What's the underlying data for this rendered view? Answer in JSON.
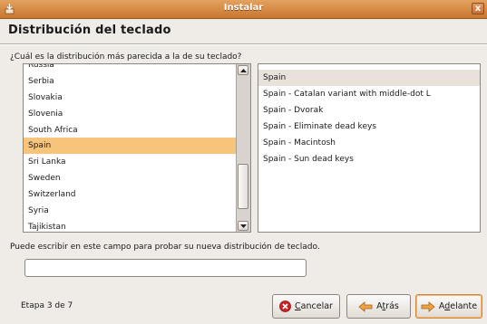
{
  "window": {
    "title": "Instalar",
    "close_label": "x"
  },
  "page": {
    "heading": "Distribución del teclado",
    "question": "¿Cuál es la distribución más parecida a la de su teclado?"
  },
  "layouts": {
    "items": [
      {
        "label": "Russia"
      },
      {
        "label": "Serbia"
      },
      {
        "label": "Slovakia"
      },
      {
        "label": "Slovenia"
      },
      {
        "label": "South Africa"
      },
      {
        "label": "Spain",
        "selected": true
      },
      {
        "label": "Sri Lanka"
      },
      {
        "label": "Sweden"
      },
      {
        "label": "Switzerland"
      },
      {
        "label": "Syria"
      },
      {
        "label": "Tajikistan"
      }
    ]
  },
  "variants": {
    "items": [
      {
        "label": "Spain",
        "selected": true
      },
      {
        "label": "Spain - Catalan variant with middle-dot L"
      },
      {
        "label": "Spain - Dvorak"
      },
      {
        "label": "Spain - Eliminate dead keys"
      },
      {
        "label": "Spain - Macintosh"
      },
      {
        "label": "Spain - Sun dead keys"
      }
    ]
  },
  "test": {
    "label": "Puede escribir en este campo para probar su nueva distribución de teclado.",
    "value": ""
  },
  "footer": {
    "step": "Etapa 3 de 7",
    "cancel": {
      "mnemonic": "C",
      "rest": "ancelar"
    },
    "back": {
      "mnemonic": "t",
      "pre": "A",
      "rest": "rás"
    },
    "next": {
      "mnemonic": "d",
      "pre": "A",
      "rest": "elante"
    }
  },
  "colors": {
    "titlebar": "#d08a45",
    "selection": "#f6c47b",
    "window_bg": "#efebe7"
  }
}
